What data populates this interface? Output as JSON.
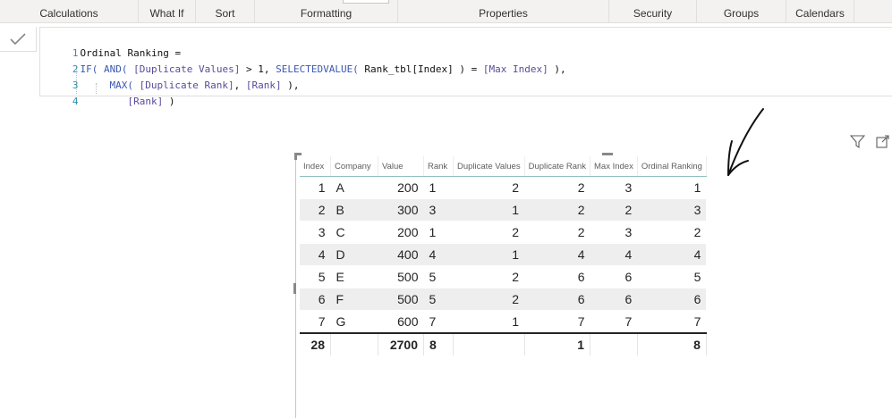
{
  "ribbon": {
    "groups": [
      "Calculations",
      "What If",
      "Sort",
      "Formatting",
      "Properties",
      "Security",
      "Groups",
      "Calendars"
    ]
  },
  "formula": {
    "line_numbers": [
      "1",
      "2",
      "3",
      "4"
    ],
    "line1": "Ordinal Ranking =",
    "line2": {
      "if": "IF(",
      "and": " AND(",
      "col1": " [Duplicate Values]",
      "t1": " > 1, ",
      "sel": "SELECTEDVALUE(",
      "t2": " Rank_tbl[Index] ) = ",
      "col2": "[Max Index]",
      "t3": " ),"
    },
    "line3": {
      "max": "MAX(",
      "col1": " [Duplicate Rank]",
      "t1": ", ",
      "col2": "[Rank]",
      "t2": " ),"
    },
    "line4": {
      "col": "[Rank]",
      "t": " )"
    }
  },
  "table": {
    "headers": [
      "Index",
      "Company",
      "Value",
      "Rank",
      "Duplicate Values",
      "Duplicate Rank",
      "Max Index",
      "Ordinal Ranking"
    ],
    "rows": [
      [
        "1",
        "A",
        "200",
        "1",
        "2",
        "2",
        "3",
        "1"
      ],
      [
        "2",
        "B",
        "300",
        "3",
        "1",
        "2",
        "2",
        "3"
      ],
      [
        "3",
        "C",
        "200",
        "1",
        "2",
        "2",
        "3",
        "2"
      ],
      [
        "4",
        "D",
        "400",
        "4",
        "1",
        "4",
        "4",
        "4"
      ],
      [
        "5",
        "E",
        "500",
        "5",
        "2",
        "6",
        "6",
        "5"
      ],
      [
        "6",
        "F",
        "500",
        "5",
        "2",
        "6",
        "6",
        "6"
      ],
      [
        "7",
        "G",
        "600",
        "7",
        "1",
        "7",
        "7",
        "7"
      ]
    ],
    "total": [
      "28",
      "",
      "2700",
      "8",
      "",
      "1",
      "",
      "8"
    ]
  },
  "icons": {
    "commit": "checkmark-icon",
    "filter": "filter-icon",
    "focus": "focus-mode-icon",
    "annotation": "hand-drawn-arrow"
  },
  "colors": {
    "line_numbers": "#2b91af",
    "function": "#3b58b3",
    "column_ref": "#5a4a9c",
    "header_rule": "#8fbfbe",
    "row_band": "#eeeeee"
  }
}
